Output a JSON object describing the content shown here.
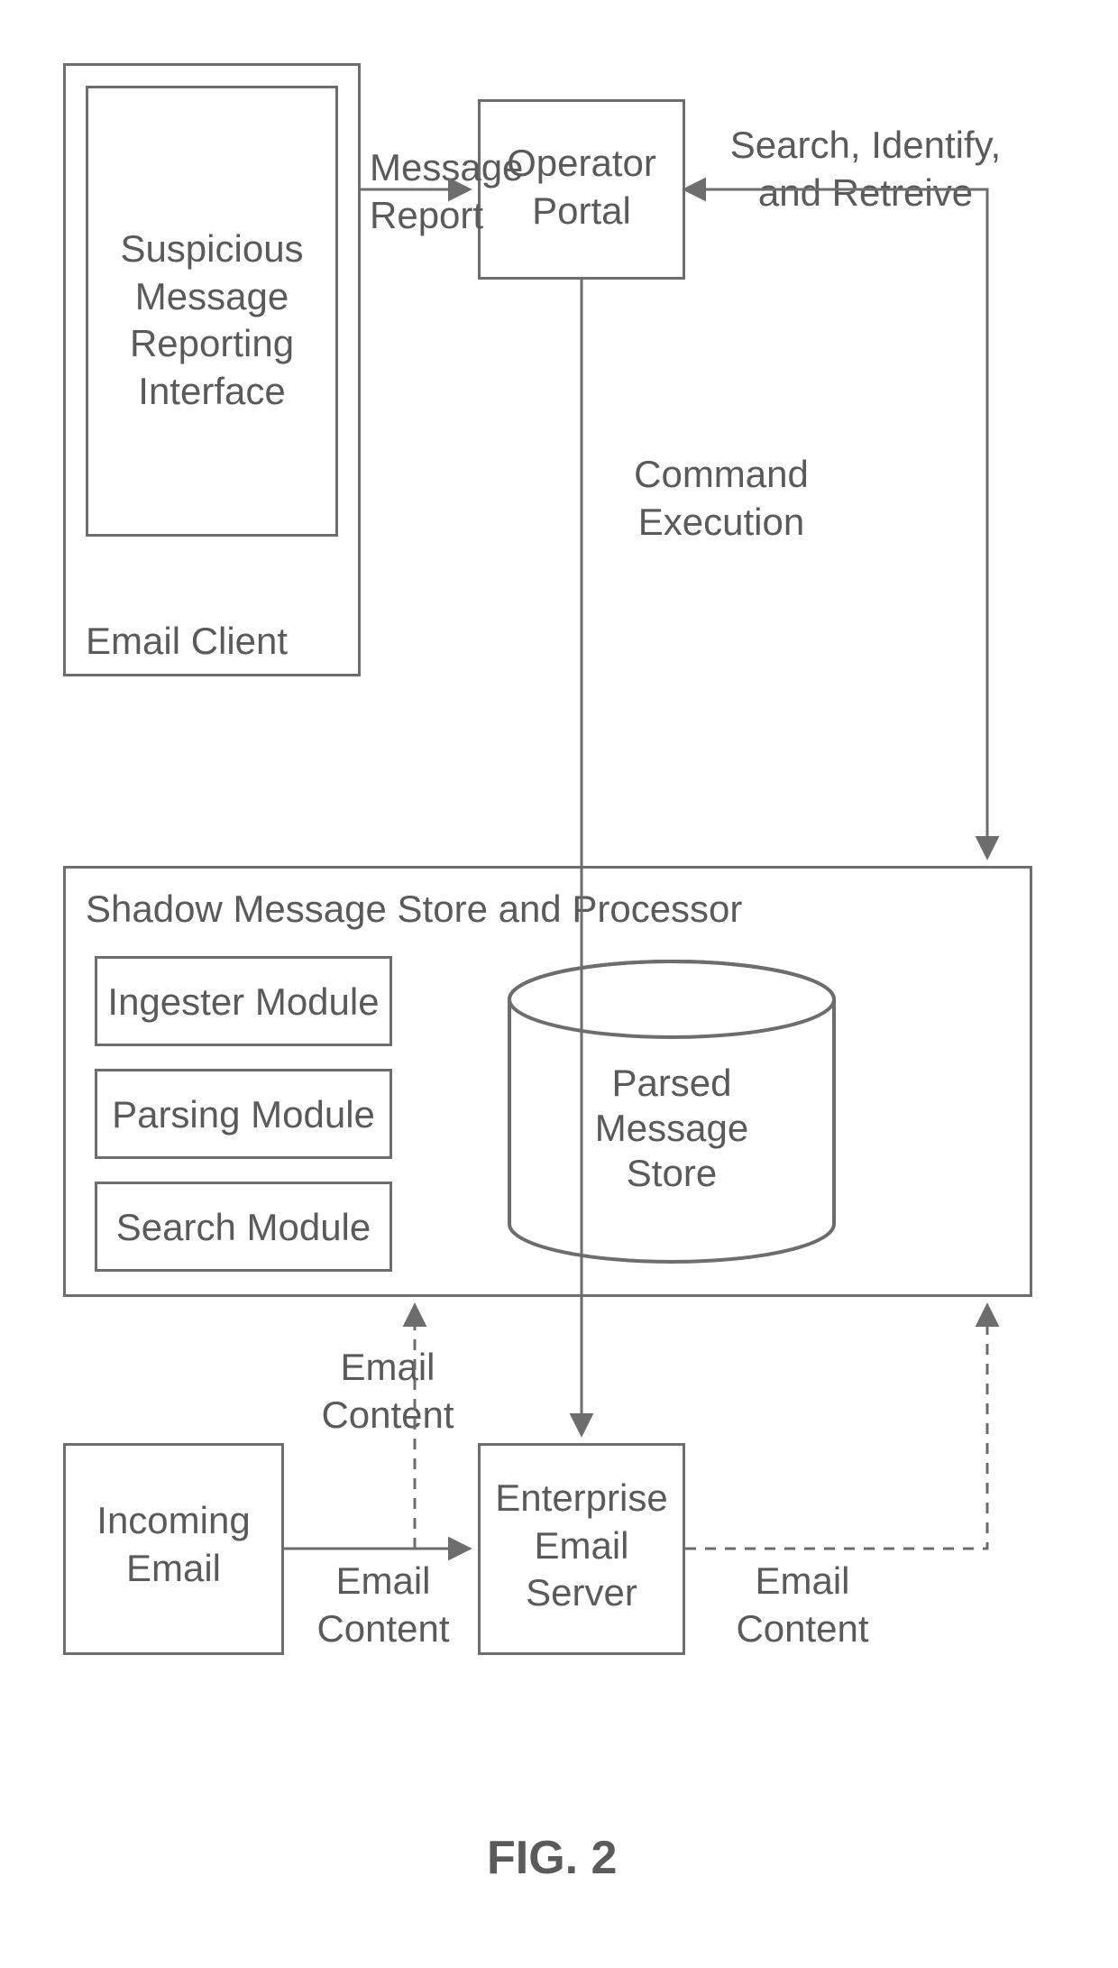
{
  "figure_caption": "FIG. 2",
  "boxes": {
    "email_client": {
      "title": "Email Client",
      "inner": "Suspicious Message Reporting Interface"
    },
    "operator_portal": "Operator Portal",
    "shadow_processor": {
      "title": "Shadow Message Store and Processor",
      "modules": {
        "ingester": "Ingester Module",
        "parsing": "Parsing Module",
        "search": "Search Module"
      },
      "db": {
        "line1": "Parsed",
        "line2": "Message",
        "line3": "Store"
      }
    },
    "incoming_email": "Incoming Email",
    "enterprise_server": "Enterprise Email Server"
  },
  "edges": {
    "message_report": "Message Report",
    "search_identify": "Search, Identify, and Retreive",
    "email_content_a": "Email Content",
    "email_content_b": "Email Content",
    "email_content_c": "Email Content",
    "command_execution": "Command Execution"
  }
}
